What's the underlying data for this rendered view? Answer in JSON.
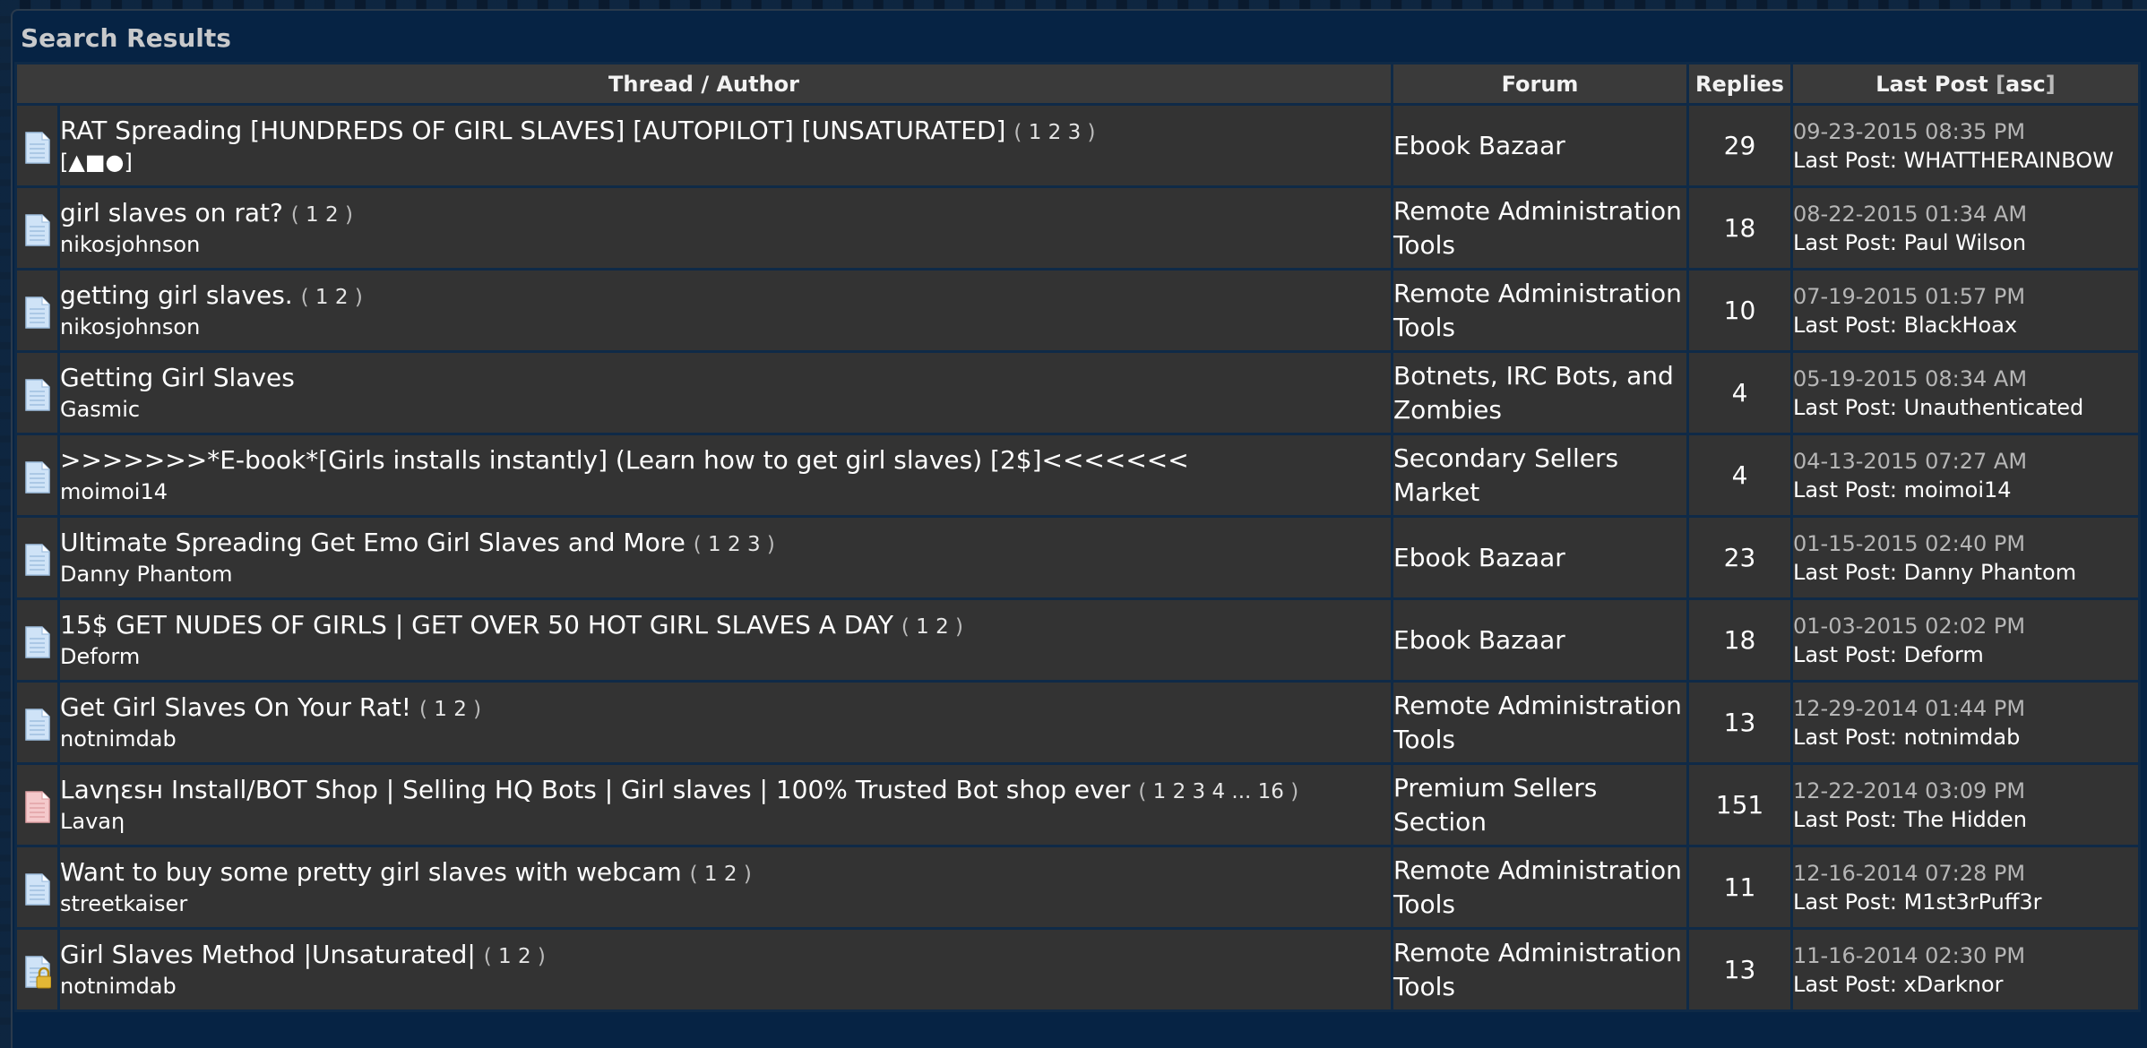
{
  "panel": {
    "title": "Search Results"
  },
  "columns": {
    "thread": "Thread / Author",
    "forum": "Forum",
    "replies": "Replies",
    "last_post": "Last Post",
    "sort_open": "[",
    "sort_label": "asc",
    "sort_close": "]"
  },
  "last_post_prefix": "Last Post:",
  "rows": [
    {
      "icon": "document-icon",
      "title": "RAT Spreading [HUNDREDS OF GIRL SLAVES] [AUTOPILOT] [UNSATURATED]",
      "pages": [
        "1",
        "2",
        "3"
      ],
      "author": "[▲■●]",
      "forum": "Ebook Bazaar",
      "replies": "29",
      "date": "09-23-2015 08:35 PM",
      "last_by": "WHATTHERAINBOW"
    },
    {
      "icon": "document-icon",
      "title": "girl slaves on rat?",
      "pages": [
        "1",
        "2"
      ],
      "author": "nikosjohnson",
      "forum": "Remote Administration Tools",
      "replies": "18",
      "date": "08-22-2015 01:34 AM",
      "last_by": "Paul Wilson"
    },
    {
      "icon": "document-icon",
      "title": "getting girl slaves.",
      "pages": [
        "1",
        "2"
      ],
      "author": "nikosjohnson",
      "forum": "Remote Administration Tools",
      "replies": "10",
      "date": "07-19-2015 01:57 PM",
      "last_by": "BlackHoax"
    },
    {
      "icon": "document-icon",
      "title": "Getting Girl Slaves",
      "pages": [],
      "author": "Gasmic",
      "forum": "Botnets, IRC Bots, and Zombies",
      "replies": "4",
      "date": "05-19-2015 08:34 AM",
      "last_by": "Unauthenticated"
    },
    {
      "icon": "document-icon",
      "title": ">>>>>>>*E-book*[Girls installs instantly] (Learn how to get girl slaves) [2$]<<<<<<<",
      "pages": [],
      "author": "moimoi14",
      "forum": "Secondary Sellers Market",
      "replies": "4",
      "date": "04-13-2015 07:27 AM",
      "last_by": "moimoi14"
    },
    {
      "icon": "document-icon",
      "title": "Ultimate Spreading Get Emo Girl Slaves and More",
      "pages": [
        "1",
        "2",
        "3"
      ],
      "author": "Danny Phantom",
      "forum": "Ebook Bazaar",
      "replies": "23",
      "date": "01-15-2015 02:40 PM",
      "last_by": "Danny Phantom"
    },
    {
      "icon": "document-icon",
      "title": "15$ GET NUDES OF GIRLS | GET OVER 50 HOT GIRL SLAVES A DAY",
      "pages": [
        "1",
        "2"
      ],
      "author": "Deform",
      "forum": "Ebook Bazaar",
      "replies": "18",
      "date": "01-03-2015 02:02 PM",
      "last_by": "Deform"
    },
    {
      "icon": "document-icon",
      "title": "Get Girl Slaves On Your Rat!",
      "pages": [
        "1",
        "2"
      ],
      "author": "notnimdab",
      "forum": "Remote Administration Tools",
      "replies": "13",
      "date": "12-29-2014 01:44 PM",
      "last_by": "notnimdab"
    },
    {
      "icon": "hot-document-icon",
      "title": "Lavηεsн Install/BOT Shop | Selling HQ Bots | Girl slaves | 100% Trusted Bot shop ever",
      "pages": [
        "1",
        "2",
        "3",
        "4",
        "...",
        "16"
      ],
      "author": "Lavaη",
      "forum": "Premium Sellers Section",
      "replies": "151",
      "date": "12-22-2014 03:09 PM",
      "last_by": "The Hidden"
    },
    {
      "icon": "document-icon",
      "title": "Want to buy some pretty girl slaves with webcam",
      "pages": [
        "1",
        "2"
      ],
      "author": "streetkaiser",
      "forum": "Remote Administration Tools",
      "replies": "11",
      "date": "12-16-2014 07:28 PM",
      "last_by": "M1st3rPuff3r"
    },
    {
      "icon": "locked-document-icon",
      "title": "Girl Slaves Method |Unsaturated|",
      "pages": [
        "1",
        "2"
      ],
      "author": "notnimdab",
      "forum": "Remote Administration Tools",
      "replies": "13",
      "date": "11-16-2014 02:30 PM",
      "last_by": "xDarknor"
    }
  ],
  "colors": {
    "panel_bg": "#062344",
    "cell_bg": "#333333",
    "border": "#0f2a47",
    "date_text": "#b6b6b6",
    "icon_blue": "#cfe3f7",
    "icon_pink": "#f4c9cb",
    "lock_gold": "#e2b735"
  }
}
